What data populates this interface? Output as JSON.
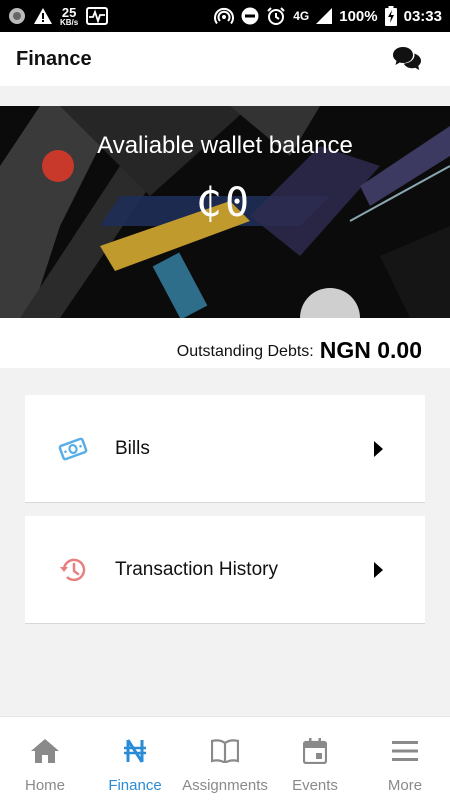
{
  "status_bar": {
    "net_speed_value": "25",
    "net_speed_unit": "KB/s",
    "network_type": "4G",
    "battery_percent": "100%",
    "time": "03:33",
    "icons": [
      "circle-app-icon",
      "warning-icon",
      "activity-icon",
      "hotspot-icon",
      "do-not-disturb-icon",
      "alarm-icon",
      "signal-icon",
      "battery-charging-icon"
    ]
  },
  "app_bar": {
    "title": "Finance",
    "chat_icon": "chat-bubbles-icon"
  },
  "wallet": {
    "title": "Avaliable wallet balance",
    "amount": "₵0"
  },
  "debts": {
    "label": "Outstanding Debts:",
    "value": "NGN 0.00"
  },
  "menu": [
    {
      "label": "Bills",
      "icon": "money-bill-icon",
      "icon_color": "#5aaee8"
    },
    {
      "label": "Transaction History",
      "icon": "history-icon",
      "icon_color": "#e88080"
    }
  ],
  "bottom_nav": [
    {
      "label": "Home",
      "icon": "home-icon",
      "active": false
    },
    {
      "label": "Finance",
      "icon": "naira-icon",
      "active": true
    },
    {
      "label": "Assignments",
      "icon": "book-icon",
      "active": false
    },
    {
      "label": "Events",
      "icon": "calendar-icon",
      "active": false
    },
    {
      "label": "More",
      "icon": "menu-icon",
      "active": false
    }
  ],
  "colors": {
    "accent": "#2a8bd6",
    "inactive": "#8a8a8a",
    "banner_bg": "#0b0b0b"
  }
}
